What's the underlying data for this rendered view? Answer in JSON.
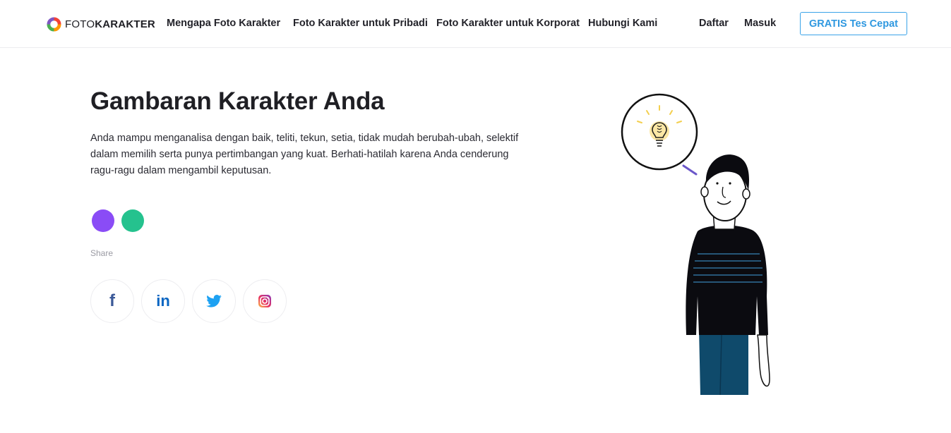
{
  "header": {
    "logo": {
      "light": "FOTO",
      "bold": "KARAKTER",
      "icon": "multicolor-ring-logo-icon"
    },
    "nav": [
      {
        "label": "Mengapa Foto Karakter"
      },
      {
        "label": "Foto Karakter untuk Pribadi"
      },
      {
        "label": "Foto Karakter untuk Korporat"
      },
      {
        "label": "Hubungi Kami"
      }
    ],
    "auth": {
      "register": "Daftar",
      "login": "Masuk"
    },
    "cta": "GRATIS Tes Cepat"
  },
  "main": {
    "title": "Gambaran Karakter Anda",
    "description": "Anda mampu menganalisa dengan baik, teliti, tekun, setia, tidak mudah berubah-ubah, selektif dalam memilih serta punya pertimbangan yang kuat. Berhati-hatilah karena Anda cenderung ragu-ragu dalam mengambil keputusan.",
    "color_dots": [
      "#8a4cf6",
      "#25c28e"
    ],
    "share_label": "Share",
    "social": [
      {
        "icon": "facebook-icon",
        "glyph": "f",
        "color": "#3b5998"
      },
      {
        "icon": "linkedin-icon",
        "glyph": "in",
        "color": "#0a66c2"
      },
      {
        "icon": "twitter-icon",
        "color": "#1da1f2"
      },
      {
        "icon": "instagram-icon",
        "color": "#d6249f"
      }
    ]
  },
  "colors": {
    "accent": "#3aa3e8",
    "text": "#1f1f24",
    "muted": "#9a9aa3"
  }
}
